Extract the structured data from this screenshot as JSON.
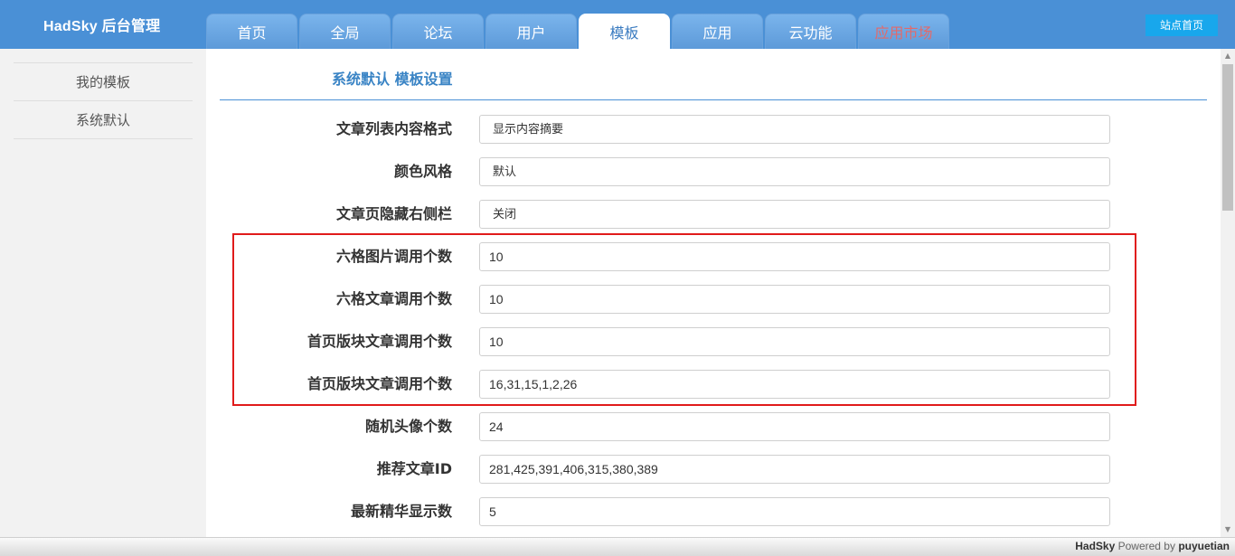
{
  "header": {
    "brand": "HadSky 后台管理",
    "site_home": "站点首页",
    "tabs": [
      {
        "label": "首页"
      },
      {
        "label": "全局"
      },
      {
        "label": "论坛"
      },
      {
        "label": "用户"
      },
      {
        "label": "模板"
      },
      {
        "label": "应用"
      },
      {
        "label": "云功能"
      },
      {
        "label": "应用市场"
      }
    ],
    "active_tab": "模板"
  },
  "sidebar": {
    "items": [
      {
        "label": "我的模板"
      },
      {
        "label": "系统默认"
      }
    ]
  },
  "main": {
    "section_title": "系统默认 模板设置",
    "fields": [
      {
        "label": "文章列表内容格式",
        "value": "显示内容摘要"
      },
      {
        "label": "颜色风格",
        "value": "默认"
      },
      {
        "label": "文章页隐藏右侧栏",
        "value": "关闭"
      },
      {
        "label": "六格图片调用个数",
        "value": "10"
      },
      {
        "label": "六格文章调用个数",
        "value": "10"
      },
      {
        "label": "首页版块文章调用个数",
        "value": "10"
      },
      {
        "label": "首页版块文章调用个数",
        "value": "16,31,15,1,2,26"
      },
      {
        "label": "随机头像个数",
        "value": "24"
      },
      {
        "label": "推荐文章ID",
        "value": "281,425,391,406,315,380,389"
      },
      {
        "label": "最新精华显示数",
        "value": "5"
      }
    ]
  },
  "footer": {
    "brand": "HadSky",
    "powered": "Powered by",
    "author": "puyuetian"
  },
  "colors": {
    "header_bg": "#4a90d6",
    "accent": "#3a84c5",
    "highlight": "#e01b1b",
    "site_home_bg": "#18a7ec"
  }
}
